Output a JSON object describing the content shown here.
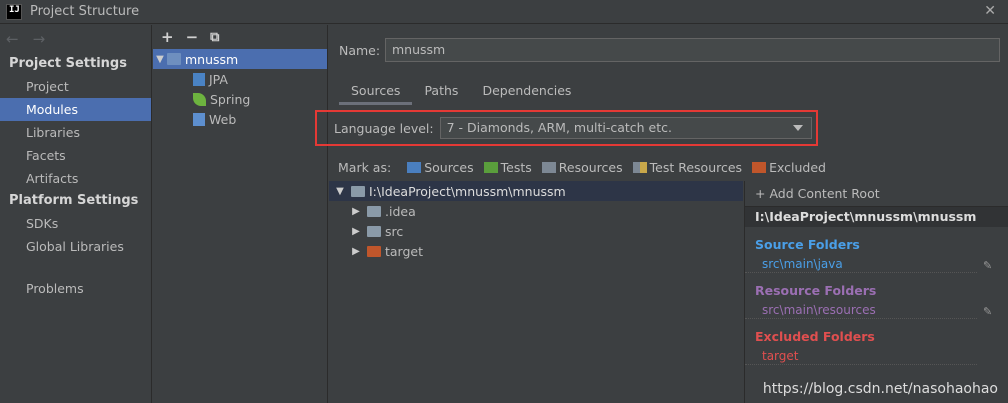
{
  "window": {
    "title": "Project Structure",
    "app_icon": "IJ"
  },
  "nav": {
    "back": "←",
    "forward": "→"
  },
  "left": {
    "project_settings_header": "Project Settings",
    "project_items": [
      "Project",
      "Modules",
      "Libraries",
      "Facets",
      "Artifacts"
    ],
    "platform_settings_header": "Platform Settings",
    "platform_items": [
      "SDKs",
      "Global Libraries"
    ],
    "problems": "Problems"
  },
  "modules_toolbar": {
    "add": "+",
    "remove": "−",
    "copy": "⧉"
  },
  "module_tree": {
    "root": "mnussm",
    "children": [
      "JPA",
      "Spring",
      "Web"
    ]
  },
  "main": {
    "name_label": "Name:",
    "name_value": "mnussm",
    "tabs": [
      "Sources",
      "Paths",
      "Dependencies"
    ],
    "language_level_label": "Language level:",
    "language_level_value": "7 - Diamonds, ARM, multi-catch etc.",
    "mark_as_label": "Mark as:",
    "mark_as": [
      "Sources",
      "Tests",
      "Resources",
      "Test Resources",
      "Excluded"
    ]
  },
  "content_tree": {
    "root": "I:\\IdeaProject\\mnussm\\mnussm",
    "children": [
      ".idea",
      "src",
      "target"
    ]
  },
  "roots": {
    "add_root": "+ Add Content Root",
    "root_path": "I:\\IdeaProject\\mnussm\\mnussm",
    "source_title": "Source Folders",
    "source_path": "src\\main\\java",
    "resource_title": "Resource Folders",
    "resource_path": "src\\main\\resources",
    "excluded_title": "Excluded Folders",
    "excluded_path": "target"
  },
  "watermark": "https://blog.csdn.net/nasohaohao",
  "colors": {
    "selection": "#4b6eaf",
    "source": "#4a9fe8",
    "resource": "#9b6fb3",
    "excluded": "#e04f4f",
    "highlight_box": "#e53935"
  }
}
